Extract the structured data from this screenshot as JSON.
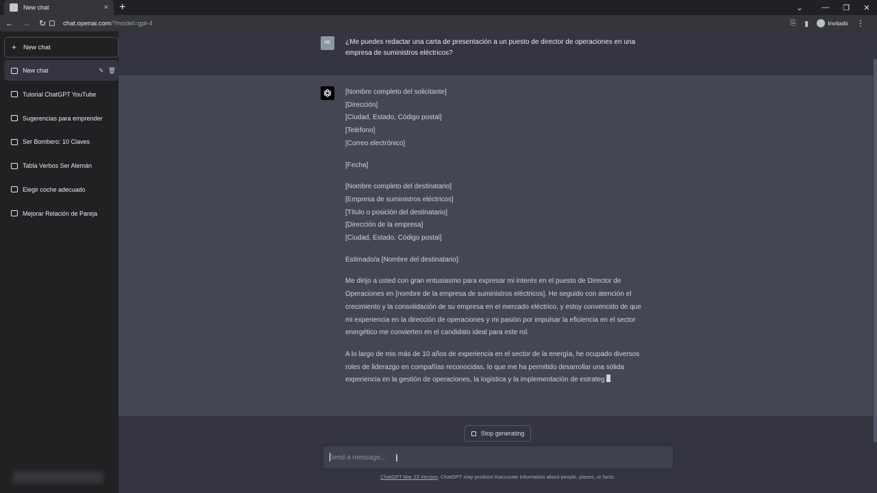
{
  "browser": {
    "tab_title": "New chat",
    "tab_close": "×",
    "new_tab": "+",
    "url_host": "chat.openai.com",
    "url_path": "/?model=gpt-4",
    "profile_name": "Invitado"
  },
  "sidebar": {
    "new_chat_label": "New chat",
    "items": [
      {
        "label": "New chat"
      },
      {
        "label": "Tutorial ChatGPT YouTube"
      },
      {
        "label": "Sugerencias para emprender"
      },
      {
        "label": "Ser Bombero: 10 Claves"
      },
      {
        "label": "Tabla Verbos Ser Alemán"
      },
      {
        "label": "Elegir coche adecuado"
      },
      {
        "label": "Mejorar Relación de Pareja"
      }
    ]
  },
  "conversation": {
    "user_avatar": "RE",
    "user_message": "¿Me puedes redactar una carta de presentación a un puesto de director de operaciones en una empresa de suministros eléctricos?",
    "assistant": {
      "sender_block": [
        "[Nombre completo del solicitante]",
        "[Dirección]",
        "[Ciudad, Estado, Código postal]",
        "[Teléfono]",
        "[Correo electrónico]"
      ],
      "date": "[Fecha]",
      "recipient_block": [
        "[Nombre completo del destinatario]",
        "[Empresa de suministros eléctricos]",
        "[Título o posición del destinatario]",
        "[Dirección de la empresa]",
        "[Ciudad, Estado, Código postal]"
      ],
      "greeting": "Estimado/a [Nombre del destinatario]:",
      "paragraph1": "Me dirijo a usted con gran entusiasmo para expresar mi interés en el puesto de Director de Operaciones en [nombre de la empresa de suministros eléctricos]. He seguido con atención el crecimiento y la consolidación de su empresa en el mercado eléctrico, y estoy convencido de que mi experiencia en la dirección de operaciones y mi pasión por impulsar la eficiencia en el sector energético me convierten en el candidato ideal para este rol.",
      "paragraph2": "A lo largo de mis más de 10 años de experiencia en el sector de la energía, he ocupado diversos roles de liderazgo en compañías reconocidas, lo que me ha permitido desarrollar una sólida experiencia en la gestión de operaciones, la logística y la implementación de estrateg"
    }
  },
  "controls": {
    "stop_label": "Stop generating",
    "input_placeholder": "Send a message...",
    "send_icon": "··"
  },
  "footer": {
    "link_text": "ChatGPT Mar 23 Version",
    "note_text": ". ChatGPT may produce inaccurate information about people, places, or facts."
  }
}
